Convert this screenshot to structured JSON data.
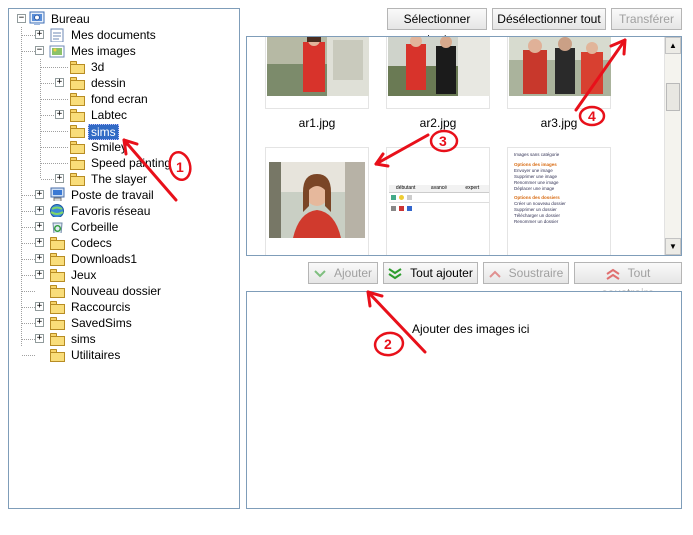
{
  "tree": {
    "items": [
      {
        "label": "Bureau",
        "icon": "desktop-icon"
      },
      {
        "label": "Mes documents",
        "icon": "documents-icon"
      },
      {
        "label": "Mes images",
        "icon": "pictures-icon"
      },
      {
        "label": "3d",
        "icon": "folder-icon"
      },
      {
        "label": "dessin",
        "icon": "folder-icon"
      },
      {
        "label": "fond ecran",
        "icon": "folder-icon"
      },
      {
        "label": "Labtec",
        "icon": "folder-icon"
      },
      {
        "label": "sims",
        "icon": "folder-icon",
        "selected": true
      },
      {
        "label": "Smiley",
        "icon": "folder-icon"
      },
      {
        "label": "Speed painting",
        "icon": "folder-icon"
      },
      {
        "label": "The slayer",
        "icon": "folder-icon"
      },
      {
        "label": "Poste de travail",
        "icon": "computer-icon"
      },
      {
        "label": "Favoris réseau",
        "icon": "network-icon"
      },
      {
        "label": "Corbeille",
        "icon": "recycle-bin-icon"
      },
      {
        "label": "Codecs",
        "icon": "folder-icon"
      },
      {
        "label": "Downloads1",
        "icon": "folder-icon"
      },
      {
        "label": "Jeux",
        "icon": "folder-icon"
      },
      {
        "label": "Nouveau dossier",
        "icon": "folder-icon"
      },
      {
        "label": "Raccourcis",
        "icon": "folder-icon"
      },
      {
        "label": "SavedSims",
        "icon": "folder-icon"
      },
      {
        "label": "sims",
        "icon": "folder-icon"
      },
      {
        "label": "Utilitaires",
        "icon": "folder-icon"
      }
    ]
  },
  "toolbar": {
    "select_all": "Sélectionner tout",
    "deselect_all": "Désélectionner tout",
    "transfer": "Transférer"
  },
  "thumbnails": [
    {
      "name": "ar1.jpg"
    },
    {
      "name": "ar2.jpg"
    },
    {
      "name": "ar3.jpg"
    }
  ],
  "actions": {
    "add": "Ajouter",
    "add_all": "Tout ajouter",
    "remove": "Soustraire",
    "remove_all": "Tout soustraire"
  },
  "drop_area": {
    "hint": "Ajouter des images ici"
  },
  "preview": {
    "tab1": "débutant",
    "tab2": "avancé",
    "tab3": "expert",
    "doc_heading": "Images sans catégorie",
    "section1": "Options des images",
    "s1_items": [
      "Envoyer une image",
      "Supprimer une image",
      "Renommer une image",
      "Déplacer une image"
    ],
    "section2": "Options des dossiers",
    "s2_items": [
      "Créer un nouveau dossier",
      "Supprimer un dossier",
      "Télécharger un dossier",
      "Renommer un dossier"
    ]
  },
  "annotations": [
    "1",
    "2",
    "3",
    "4"
  ],
  "colors": {
    "selection": "#316ac5",
    "annotation": "#e8101a",
    "border": "#7f9db9"
  }
}
